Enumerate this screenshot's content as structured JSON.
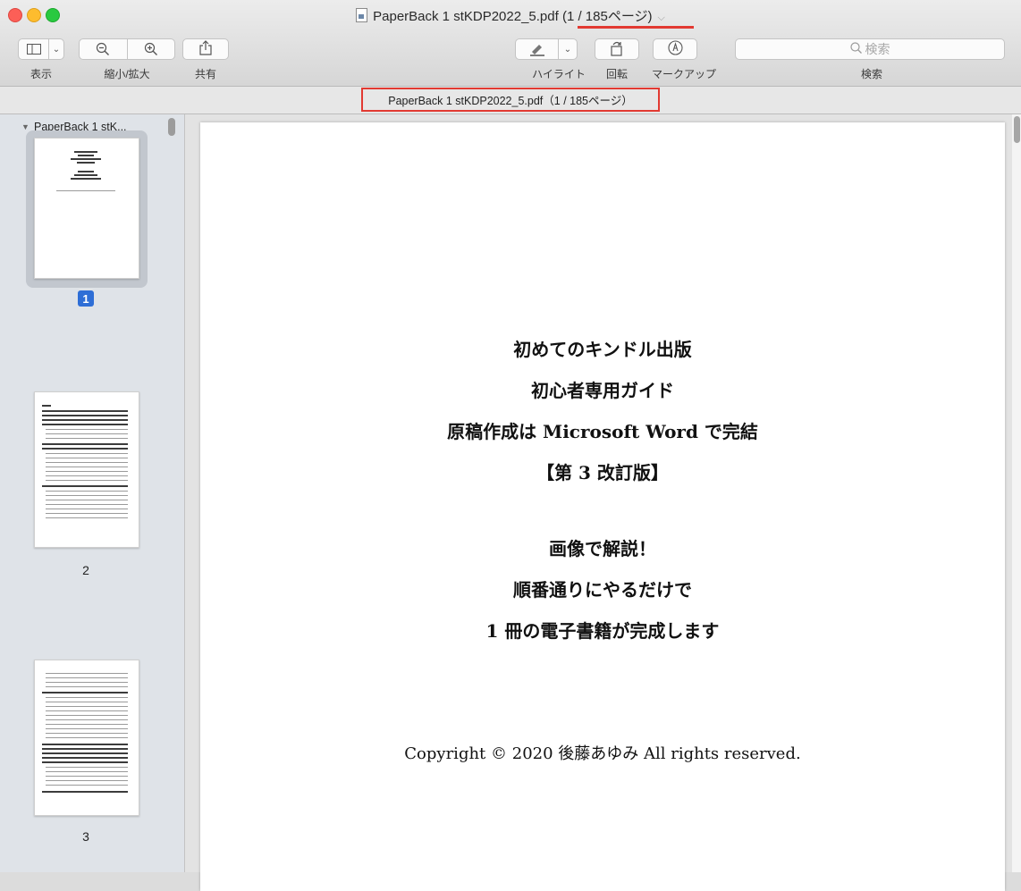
{
  "window": {
    "title": "PaperBack 1 stKDP2022_5.pdf",
    "page_indicator": "(1 / 185ページ)",
    "title_chevron": "⌵"
  },
  "toolbar": {
    "view_icon": "sidebar-toggle-icon",
    "view_label": "表示",
    "zoom_label": "縮小/拡大",
    "share_label": "共有",
    "highlight_label": "ハイライト",
    "rotate_label": "回転",
    "markup_label": "マークアップ",
    "search_placeholder": "検索",
    "search_label": "検索"
  },
  "document_bar": {
    "label": "PaperBack 1 stKDP2022_5.pdf（1 / 185ページ）"
  },
  "sidebar": {
    "header": "PaperBack 1 stK...",
    "thumbnails": [
      {
        "label": "1",
        "selected": true
      },
      {
        "label": "2",
        "selected": false
      },
      {
        "label": "3",
        "selected": false
      }
    ]
  },
  "page_content": {
    "lines": [
      "初めてのキンドル出版",
      "初心者専用ガイド",
      "原稿作成は Microsoft Word で完結",
      "【第 3 改訂版】",
      "画像で解説！",
      "順番通りにやるだけで",
      "1 冊の電子書籍が完成します"
    ],
    "copyright": "Copyright © 2020  後藤あゆみ  All rights reserved."
  },
  "colors": {
    "annotation_red": "#e23a32",
    "selection_blue": "#2e6ed6"
  }
}
